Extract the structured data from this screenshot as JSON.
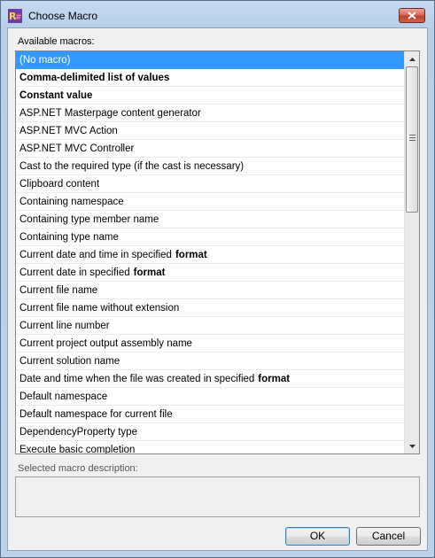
{
  "window": {
    "title": "Choose Macro"
  },
  "labels": {
    "available": "Available macros:",
    "description": "Selected macro description:"
  },
  "description": {
    "text": ""
  },
  "macros": [
    {
      "label": "(No macro)",
      "style": "selected"
    },
    {
      "label": "Comma-delimited list of values",
      "style": "bold"
    },
    {
      "label": "Constant value",
      "style": "bold"
    },
    {
      "label": "ASP.NET Masterpage content generator"
    },
    {
      "label": "ASP.NET MVC Action"
    },
    {
      "label": "ASP.NET MVC Controller"
    },
    {
      "label": "Cast to the required type (if the cast is necessary)"
    },
    {
      "label": "Clipboard content"
    },
    {
      "label": "Containing namespace"
    },
    {
      "label": "Containing type member name"
    },
    {
      "label": "Containing type name"
    },
    {
      "label": "Current date and time in specified",
      "suffix": "format"
    },
    {
      "label": "Current date in specified",
      "suffix": "format"
    },
    {
      "label": "Current file name"
    },
    {
      "label": "Current file name without extension"
    },
    {
      "label": "Current line number"
    },
    {
      "label": "Current project output assembly name"
    },
    {
      "label": "Current solution name"
    },
    {
      "label": "Date and time when the file was created in specified",
      "suffix": "format"
    },
    {
      "label": "Default namespace"
    },
    {
      "label": "Default namespace for current file"
    },
    {
      "label": "DependencyProperty type"
    },
    {
      "label": "Execute basic completion"
    }
  ],
  "buttons": {
    "ok": "OK",
    "cancel": "Cancel"
  },
  "colors": {
    "selection": "#3399ff",
    "title_bar": "#c5daf1",
    "close": "#c0422b"
  },
  "icons": {
    "app": "resharper-icon",
    "close": "close-icon",
    "scroll_up": "chevron-up-icon",
    "scroll_down": "chevron-down-icon"
  }
}
